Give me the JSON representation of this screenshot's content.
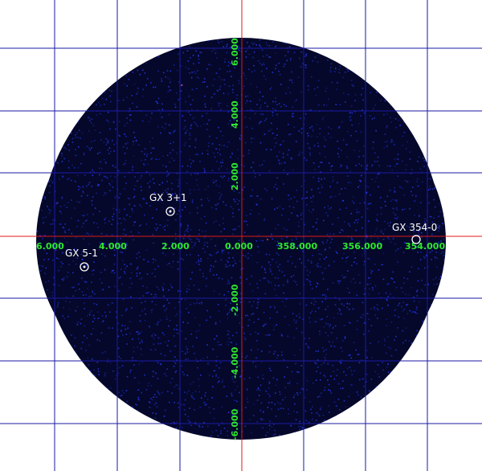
{
  "colors": {
    "background": "#ffffff",
    "field": "#05082a",
    "noise": "#2233dd",
    "grid": "#1a1aa6",
    "axes": "#e01818",
    "tick_labels": "#2ee82e",
    "source_markers": "#ffffff"
  },
  "axes": {
    "x_ticks": [
      "6.000",
      "4.000",
      "2.000",
      "0.000",
      "358.000",
      "356.000",
      "354.000"
    ],
    "y_ticks": [
      "6.000",
      "4.000",
      "2.000",
      "-2.000",
      "-4.000",
      "-6.000"
    ]
  },
  "sources": [
    {
      "name": "GX 3+1"
    },
    {
      "name": "GX 5-1"
    },
    {
      "name": "GX 354-0"
    }
  ]
}
